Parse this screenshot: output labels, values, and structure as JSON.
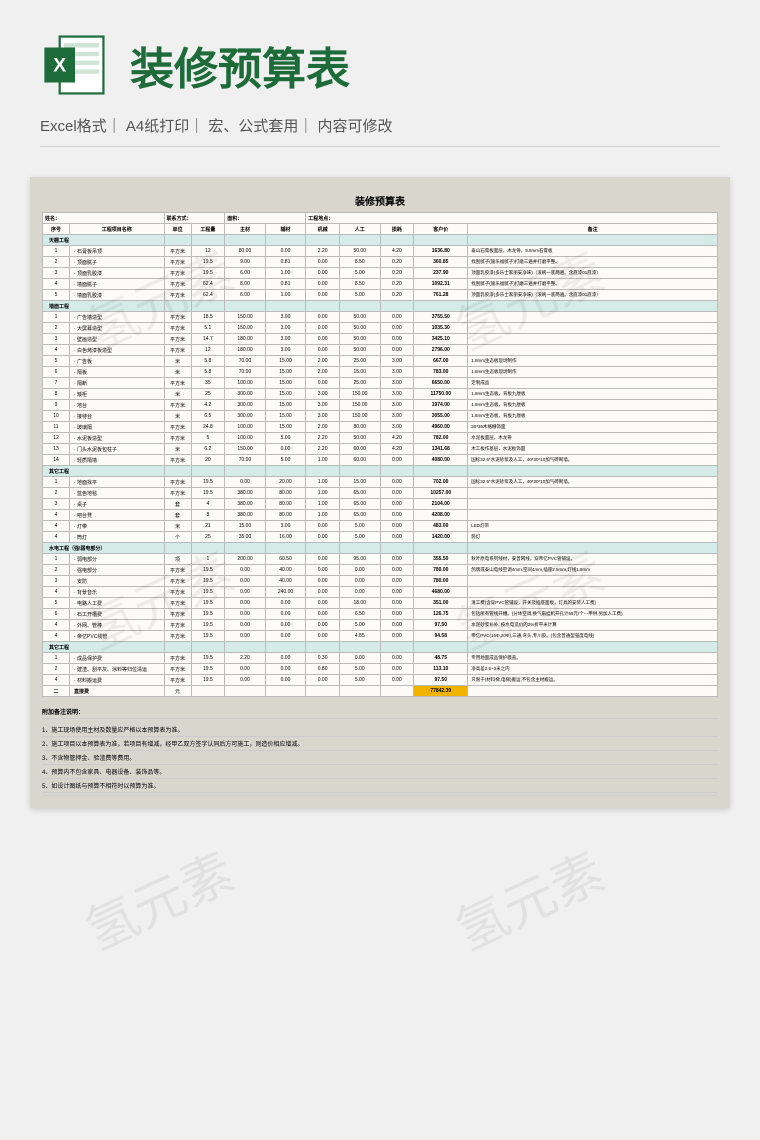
{
  "header": {
    "title": "装修预算表",
    "meta": "Excel格式｜ A4纸打印｜ 宏、公式套用｜ 内容可修改"
  },
  "sheet": {
    "title": "装修预算表",
    "infoRow": {
      "a": "姓名：",
      "b": "联系方式：",
      "c": "面积：",
      "d": "工程地点："
    },
    "columns": [
      "序号",
      "工程项目名称",
      "单位",
      "工程量",
      "主材",
      "辅材",
      "机械",
      "人工",
      "损耗",
      "客户价",
      "备注"
    ],
    "sections": [
      {
        "name": "天棚工程",
        "rows": [
          [
            "1",
            "· 石膏板吊顶",
            "平方米",
            "12",
            "80.00",
            "0.00",
            "2.20",
            "50.00",
            "4.20",
            "1636.80",
            "泰山石膏板面层，木龙骨，9.5mm石膏板"
          ],
          [
            "2",
            "· 顶面腻子",
            "平方米",
            "19.5",
            "9.00",
            "0.81",
            "0.00",
            "8.50",
            "0.20",
            "360.85",
            "找刮腻子(施乐福腻子)打磨三遍并打磨平整。"
          ],
          [
            "3",
            "· 顶面乳胶漆",
            "平方米",
            "19.5",
            "6.00",
            "1.00",
            "0.00",
            "5.00",
            "0.20",
            "237.90",
            "顶面乳胶漆(多乐士家丽安净味)（滚刷一底两遍。含底漆01底漆）"
          ],
          [
            "4",
            "· 墙面腻子",
            "平方米",
            "62.4",
            "8.00",
            "0.81",
            "0.00",
            "8.50",
            "0.20",
            "1092.31",
            "找刮腻子(施乐福腻子)打磨三遍并打磨平整。"
          ],
          [
            "5",
            "· 墙面乳胶漆",
            "平方米",
            "62.4",
            "6.00",
            "1.00",
            "0.00",
            "5.00",
            "0.20",
            "761.28",
            "顶面乳胶漆(多乐士家丽安净味)（滚刷一底两遍。含底漆01底漆）"
          ]
        ]
      },
      {
        "name": "墙面工程",
        "rows": [
          [
            "1",
            "· 广告墙造型",
            "平方米",
            "18.5",
            "150.00",
            "3.00",
            "0.00",
            "50.00",
            "0.00",
            "3755.50",
            ""
          ],
          [
            "2",
            "· 大屏幕造型",
            "平方米",
            "5.1",
            "150.00",
            "3.00",
            "0.00",
            "50.00",
            "0.00",
            "1035.30",
            ""
          ],
          [
            "3",
            "· 壁画造型",
            "平方米",
            "14.7",
            "180.00",
            "3.00",
            "0.00",
            "50.00",
            "0.00",
            "3425.10",
            ""
          ],
          [
            "4",
            "· 白色烤漆板造型",
            "平方米",
            "12",
            "180.00",
            "3.00",
            "0.00",
            "50.00",
            "0.00",
            "2796.00",
            ""
          ],
          [
            "5",
            "· 广告板",
            "米",
            "5.8",
            "70.00",
            "15.00",
            "2.00",
            "25.00",
            "3.00",
            "667.00",
            "1.8mm生态板现场制作"
          ],
          [
            "6",
            "· 隔板",
            "米",
            "5.8",
            "70.00",
            "15.00",
            "2.00",
            "15.00",
            "3.00",
            "783.00",
            "1.8mm生态板现场制作"
          ],
          [
            "7",
            "· 隔断",
            "平方米",
            "35",
            "100.00",
            "15.00",
            "0.00",
            "25.00",
            "3.00",
            "6650.00",
            "定制成品"
          ],
          [
            "8",
            "· 矮柜",
            "米",
            "25",
            "300.00",
            "15.00",
            "3.00",
            "150.00",
            "3.00",
            "11750.00",
            "1.8mm生态板，背板九厘板"
          ],
          [
            "9",
            "· 地台",
            "平方米",
            "4.2",
            "300.00",
            "15.00",
            "3.00",
            "150.00",
            "3.00",
            "1974.00",
            "1.8mm生态板，背板九厘板"
          ],
          [
            "10",
            "· 接待台",
            "米",
            "6.5",
            "300.00",
            "15.00",
            "3.00",
            "150.00",
            "3.00",
            "3055.00",
            "1.8mm生态板，背板九厘板"
          ],
          [
            "11",
            "· 玻璃隔",
            "平方米",
            "24.8",
            "100.00",
            "15.00",
            "2.00",
            "80.00",
            "3.00",
            "4960.00",
            "30*35木格栅饰面"
          ],
          [
            "12",
            "· 水泥板造型",
            "平方米",
            "5",
            "100.00",
            "5.00",
            "2.20",
            "50.00",
            "4.20",
            "782.00",
            "水泥板面层，木龙骨"
          ],
          [
            "13",
            "· 门头水泥板包柱子",
            "米",
            "6.2",
            "150.00",
            "0.00",
            "2.20",
            "60.00",
            "4.20",
            "1341.68",
            "木工板作基层，水泥板饰面"
          ],
          [
            "14",
            "· 轻质隔墙",
            "平方米",
            "20",
            "70.00",
            "5.00",
            "1.00",
            "60.00",
            "0.00",
            "4080.00",
            "国标32.5*水泥砂浆及人工，40*30*10加气砖砌墙。"
          ]
        ]
      },
      {
        "name": "其它工程",
        "rows": [
          [
            "1",
            "· 地面找平",
            "平方米",
            "19.5",
            "0.00",
            "20.00",
            "1.00",
            "15.00",
            "0.00",
            "702.00",
            "国标32.5*水泥砂浆及人工，40*30*10加气砖砌墙。"
          ],
          [
            "2",
            "· 蓝色地毯",
            "平方米",
            "19.5",
            "380.00",
            "80.00",
            "1.00",
            "65.00",
            "0.00",
            "10257.00",
            ""
          ],
          [
            "3",
            "· 桌子",
            "套",
            "4",
            "380.00",
            "80.00",
            "1.00",
            "65.00",
            "0.00",
            "2104.00",
            ""
          ],
          [
            "4",
            "· 吧台凳",
            "套",
            "8",
            "380.00",
            "80.00",
            "1.00",
            "65.00",
            "0.00",
            "4208.00",
            ""
          ],
          [
            "4",
            "· 灯带",
            "米",
            "21",
            "15.00",
            "3.00",
            "0.00",
            "5.00",
            "0.00",
            "483.00",
            "LED灯带"
          ],
          [
            "4",
            "· 筒灯",
            "个",
            "25",
            "35.00",
            "16.00",
            "0.00",
            "5.00",
            "0.00",
            "1420.00",
            "筒灯"
          ]
        ]
      },
      {
        "name": "水电工程（强\\弱电部分）",
        "rows": [
          [
            "1",
            "· 弱电部分",
            "项",
            "1",
            "200.00",
            "60.50",
            "0.00",
            "95.00",
            "0.00",
            "355.50",
            "秋叶原电系列线材，安普网线，穿帝亿PVC管铺设。"
          ],
          [
            "2",
            "· 强电部分",
            "平方米",
            "19.5",
            "0.00",
            "40.00",
            "0.00",
            "0.00",
            "0.00",
            "780.00",
            "鸽牌或泰山电线空调4mm,空间4mm,插座2.5mm,灯线1.5mm"
          ],
          [
            "3",
            "· 安防",
            "平方米",
            "19.5",
            "0.00",
            "40.00",
            "0.00",
            "0.00",
            "0.00",
            "780.00",
            ""
          ],
          [
            "4",
            "· 背景音乐",
            "平方米",
            "19.5",
            "0.00",
            "240.00",
            "0.00",
            "0.00",
            "0.00",
            "4680.00",
            ""
          ],
          [
            "5",
            "· 电路人工费",
            "平方米",
            "19.5",
            "0.00",
            "0.00",
            "0.00",
            "18.00",
            "0.00",
            "351.00",
            "清工费(含穿PVC管铺设，开关及插座面板，灯具的安装人工费)"
          ],
          [
            "6",
            "· 石工开槽费",
            "平方米",
            "19.5",
            "0.00",
            "0.00",
            "0.00",
            "6.50",
            "0.00",
            "126.75",
            "包括所有管线开槽。(分体空调,换气扇挂机开孔计65元/个---甲供,另加人工费)"
          ],
          [
            "4",
            "· 外网、管棒",
            "平方米",
            "19.5",
            "0.00",
            "0.00",
            "0.00",
            "5.00",
            "0.00",
            "97.50",
            "水泥砂浆补补, 按水电造价的2%折平米计算"
          ],
          [
            "4",
            "· 帝亿PVC线管",
            "平方米",
            "19.5",
            "0.00",
            "0.00",
            "0.00",
            "4.85",
            "0.00",
            "94.58",
            "帝亿PVC(16Φ,20Φ),三通,弯头,专川胶。(包含普通型强度电线)"
          ]
        ]
      },
      {
        "name": "其它工程",
        "rows": [
          [
            "1",
            "· 成品保护费",
            "平方米",
            "19.5",
            "2.20",
            "0.00",
            "0.30",
            "0.00",
            "0.00",
            "48.75",
            "专用地面成品保护膜盖。"
          ],
          [
            "2",
            "· 建渣、刮平灰、涂料等归位清运",
            "平方米",
            "19.5",
            "0.00",
            "0.00",
            "0.80",
            "5.00",
            "0.00",
            "113.10",
            "净高差2.5~3米之内"
          ],
          [
            "4",
            "· 材料搬运费",
            "平方米",
            "19.5",
            "0.00",
            "0.00",
            "0.00",
            "5.00",
            "0.00",
            "97.50",
            "只限于(材料梯,电梯)搬运,不包含主材搬运。"
          ]
        ]
      }
    ],
    "total": {
      "label": "直接费",
      "unit": "元",
      "value": "77842.39"
    },
    "notesTitle": "附加备注说明：",
    "notes": [
      "1、施工现场使用主材及数量应严格以本预算表为准。",
      "2、施工项目以本预算表为准，若项目有增减，经甲乙双方签字认同后方可施工，则造价相应增减。",
      "3、不含物管押金、验渣费等费用。",
      "4、预算内不包含家具、电器设备、装饰品等。",
      "5、如设计图纸与预算不相符时以预算为准。"
    ]
  },
  "watermark": "氢元素"
}
